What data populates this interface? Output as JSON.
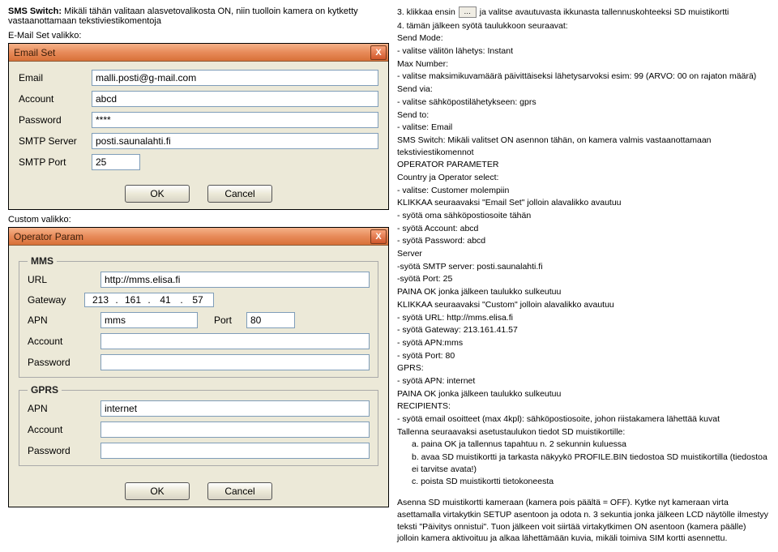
{
  "intro": {
    "before_bold": "SMS Switch:",
    "after_bold": " Mikäli tähän valitaan alasvetovalikosta ON, niin tuolloin kamera on kytketty vastaanottamaan tekstiviestikomentoja"
  },
  "labels": {
    "email_set_heading": "E-Mail Set valikko:",
    "custom_heading": "Custom valikko:"
  },
  "emailDlg": {
    "title": "Email Set",
    "close": "X",
    "email_lbl": "Email",
    "email_val": "malli.posti@g-mail.com",
    "account_lbl": "Account",
    "account_val": "abcd",
    "password_lbl": "Password",
    "password_val": "****",
    "smtp_lbl": "SMTP Server",
    "smtp_val": "posti.saunalahti.fi",
    "port_lbl": "SMTP Port",
    "port_val": "25",
    "ok": "OK",
    "cancel": "Cancel"
  },
  "opDlg": {
    "title": "Operator Param",
    "close": "X",
    "mms_legend": "MMS",
    "gprs_legend": "GPRS",
    "url_lbl": "URL",
    "url_val": "http://mms.elisa.fi",
    "gateway_lbl": "Gateway",
    "gw1": "213",
    "gw2": "161",
    "gw3": "41",
    "gw4": "57",
    "apn_lbl": "APN",
    "apn_val": "mms",
    "port_lbl": "Port",
    "port_val": "80",
    "account_lbl": "Account",
    "password_lbl": "Password",
    "gprs_apn_val": "internet",
    "ok": "OK",
    "cancel": "Cancel"
  },
  "right": {
    "step3_a": "3.   klikkaa ensin",
    "step3_btn": "…",
    "step3_b": "ja valitse avautuvasta ikkunasta tallennuskohteeksi SD muistikortti",
    "lines": [
      "4.   tämän jälkeen syötä taulukkoon seuraavat:",
      "Send Mode:",
      "- valitse välitön lähetys: Instant",
      "Max Number:",
      "- valitse maksimikuvamäärä päivittäiseksi lähetysarvoksi esim: 99 (ARVO: 00 on rajaton määrä)",
      "Send via:",
      "- valitse sähköpostilähetykseen: gprs",
      "Send to:",
      "- valitse: Email",
      "SMS Switch: Mikäli valitset ON asennon tähän, on kamera valmis vastaanottamaan tekstiviestikomennot",
      "OPERATOR PARAMETER",
      "Country ja Operator select:",
      "- valitse: Customer molempiin",
      "KLIKKAA seuraavaksi \"Email Set\" jolloin alavalikko avautuu",
      "- syötä oma sähköpostiosoite tähän",
      "- syötä Account: abcd",
      " - syötä Password: abcd",
      "Server",
      "-syötä SMTP server: posti.saunalahti.fi",
      "-syötä Port: 25",
      "PAINA OK jonka jälkeen taulukko sulkeutuu",
      "KLIKKAA seuraavaksi \"Custom\" jolloin alavalikko avautuu",
      "- syötä URL: http://mms.elisa.fi",
      "- syötä Gateway: 213.161.41.57",
      "- syötä APN:mms",
      "- syötä Port: 80",
      "GPRS:",
      "- syötä APN: internet",
      "PAINA OK jonka jälkeen taulukko sulkeutuu",
      "RECIPIENTS:",
      "- syötä email osoitteet (max 4kpl): sähköpostiosoite, johon riistakamera lähettää kuvat",
      "Tallenna seuraavaksi asetustaulukon tiedot SD muistikortille:"
    ],
    "sub_a": "a.   paina OK  ja tallennus tapahtuu n. 2 sekunnin kuluessa",
    "sub_b": "b.   avaa SD muistikortti ja tarkasta näkyykö PROFILE.BIN tiedostoa SD muistikortilla (tiedostoa ei tarvitse avata!)",
    "sub_c": "c.   poista SD muistikortti tietokoneesta",
    "final": "Asenna SD muistikortti kameraan (kamera pois päältä = OFF). Kytke nyt kameraan virta asettamalla virtakytkin SETUP asentoon ja odota n. 3 sekuntia jonka jälkeen LCD näytölle ilmestyy teksti \"Päivitys onnistui\". Tuon jälkeen voit siirtää virtakytkimen ON asentoon (kamera päälle) jolloin kamera aktivoituu ja alkaa lähettämään kuvia, mikäli toimiva SIM kortti asennettu."
  }
}
